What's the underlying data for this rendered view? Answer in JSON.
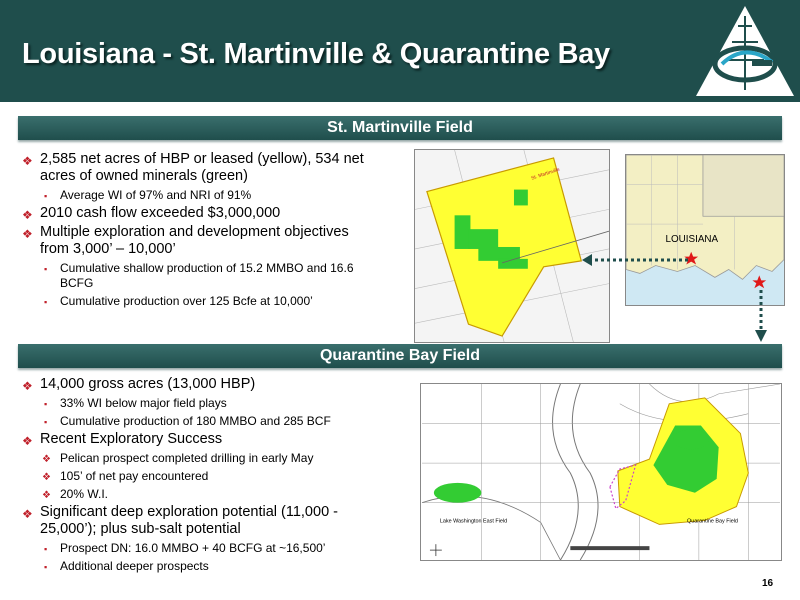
{
  "header": {
    "title": "Louisiana - St. Martinville & Quarantine Bay"
  },
  "section1": {
    "title": "St. Martinville Field",
    "bullets": [
      {
        "type": "main",
        "text": "2,585 net acres of HBP or leased (yellow), 534 net acres of owned minerals (green)"
      },
      {
        "type": "sub",
        "text": "Average WI of 97% and NRI of 91%"
      },
      {
        "type": "main",
        "text": "2010 cash flow exceeded $3,000,000"
      },
      {
        "type": "main",
        "text": "Multiple exploration and development objectives from 3,000’ – 10,000’"
      },
      {
        "type": "sub",
        "text": "Cumulative shallow production of 15.2 MMBO and 16.6 BCFG"
      },
      {
        "type": "sub",
        "text": "Cumulative production over 125 Bcfe at 10,000’"
      }
    ]
  },
  "section2": {
    "title": "Quarantine Bay Field",
    "bullets": [
      {
        "type": "main",
        "text": "14,000 gross acres (13,000 HBP)"
      },
      {
        "type": "sub",
        "text": "33% WI below major field plays"
      },
      {
        "type": "sub",
        "text": "Cumulative production of 180 MMBO and 285 BCF"
      },
      {
        "type": "main",
        "text": "Recent Exploratory Success"
      },
      {
        "type": "subd",
        "text": "Pelican prospect completed drilling in early May"
      },
      {
        "type": "subd",
        "text": "105’ of net pay encountered"
      },
      {
        "type": "subd",
        "text": "20% W.I."
      },
      {
        "type": "main",
        "text": "Significant deep exploration potential (11,000 - 25,000’); plus sub-salt potential"
      },
      {
        "type": "sub",
        "text": "Prospect DN: 16.0 MMBO + 40 BCFG at ~16,500’"
      },
      {
        "type": "sub",
        "text": "Additional deeper prospects"
      }
    ]
  },
  "maps": {
    "louisiana_label": "LOUISIANA",
    "lake_label": "Lake Washington East Field",
    "quarantine_label": "Quarantine Bay Field"
  },
  "page": {
    "number": "16"
  },
  "colors": {
    "header": "#1f4e4c",
    "bullet": "#c0202a",
    "yellow": "#ffff33",
    "green": "#33cc33",
    "water": "#cfe8f3",
    "land": "#f3efc4"
  }
}
